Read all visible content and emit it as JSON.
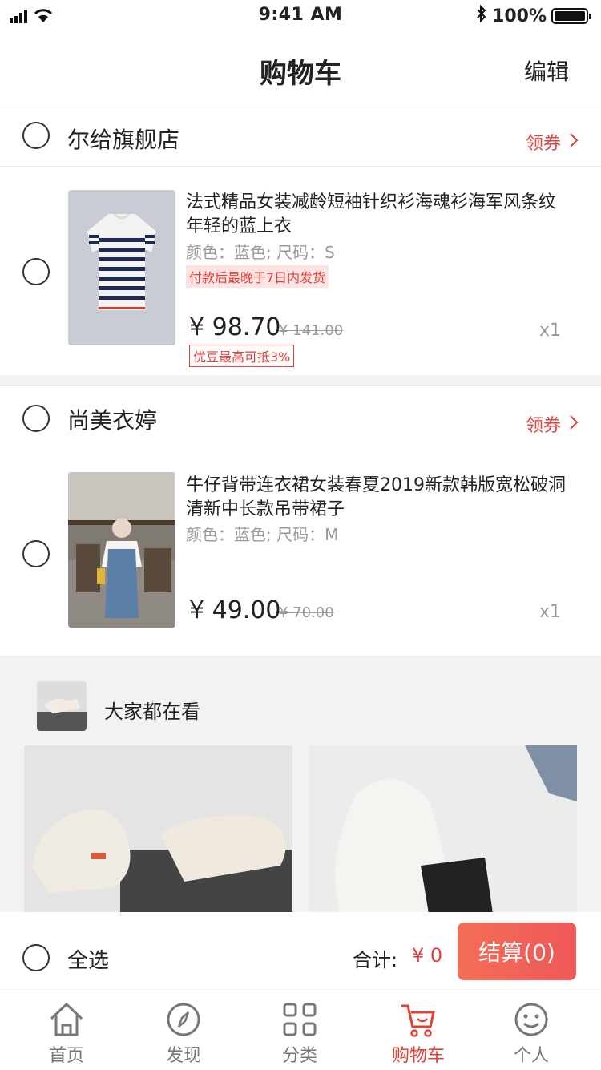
{
  "status": {
    "time": "9:41 AM",
    "battery": "100%"
  },
  "navbar": {
    "title": "购物车",
    "edit": "编辑"
  },
  "shops": [
    {
      "name": "尔给旗舰店",
      "coupon": "领券",
      "item": {
        "title": "法式精品女装减龄短袖针织衫海魂衫海军风条纹年轻的蓝上衣",
        "spec": "颜色：蓝色; 尺码：S",
        "shipping": "付款后最晚于7日内发货",
        "price": "¥ 98.70",
        "original_price": "¥ 141.00",
        "qty": "x1",
        "promo": "优豆最高可抵3%"
      }
    },
    {
      "name": "尚美衣婷",
      "coupon": "领券",
      "item": {
        "title": "牛仔背带连衣裙女装春夏2019新款韩版宽松破洞清新中长款吊带裙子",
        "spec": "颜色：蓝色; 尺码：M",
        "price": "¥ 49.00",
        "original_price": "¥ 70.00",
        "qty": "x1"
      }
    }
  ],
  "recommend": {
    "title": "大家都在看"
  },
  "bottom": {
    "select_all": "全选",
    "total_label": "合计:",
    "total_value": "¥ 0",
    "checkout": "结算(0)"
  },
  "tabs": [
    {
      "label": "首页",
      "icon": "home-icon"
    },
    {
      "label": "发现",
      "icon": "compass-icon"
    },
    {
      "label": "分类",
      "icon": "grid-icon"
    },
    {
      "label": "购物车",
      "icon": "cart-icon"
    },
    {
      "label": "个人",
      "icon": "smile-icon"
    }
  ],
  "colors": {
    "accent": "#e2413a",
    "checkout_gradient_start": "#f46e57",
    "checkout_gradient_end": "#ef5858"
  }
}
